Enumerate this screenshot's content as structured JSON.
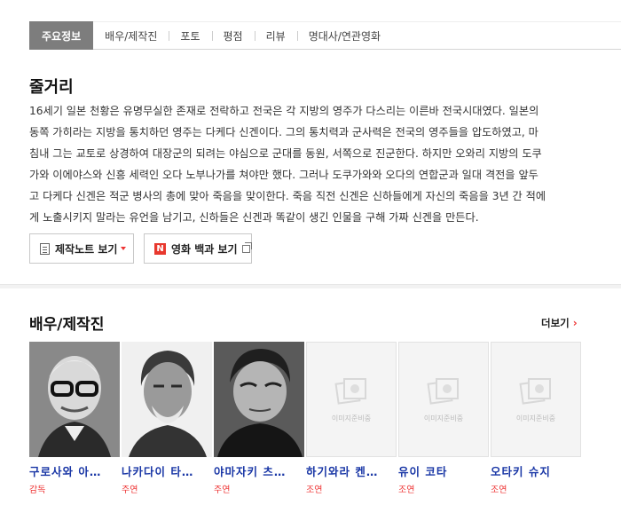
{
  "tabs": [
    {
      "label": "주요정보"
    },
    {
      "label": "배우/제작진"
    },
    {
      "label": "포토"
    },
    {
      "label": "평점"
    },
    {
      "label": "리뷰"
    },
    {
      "label": "명대사/연관영화"
    }
  ],
  "synopsis": {
    "title": "줄거리",
    "lines": [
      "16세기 일본 천황은 유명무실한 존재로 전락하고 전국은 각 지방의 영주가 다스리는 이른바 전국시대였다. 일본의",
      "동쪽 가히라는 지방을 통치하던 영주는 다케다 신겐이다. 그의 통치력과 군사력은 전국의 영주들을 압도하였고, 마",
      "침내 그는 교토로 상경하여 대장군의 되려는 야심으로 군대를 동원, 서쪽으로 진군한다. 하지만 오와리 지방의 도쿠",
      "가와 이에야스와 신흥 세력인 오다 노부나가를 쳐야만 했다. 그러나 도쿠가와와 오다의 연합군과 일대 격전을 앞두",
      "고 다케다 신겐은 적군 병사의 총에 맞아 죽음을 맞이한다. 죽음 직전 신겐은 신하들에게 자신의 죽음을 3년 간 적에",
      "게 노출시키지 말라는 유언을 남기고, 신하들은 신겐과 똑같이 생긴 인물을 구해 가짜 신겐을 만든다."
    ],
    "buttons": {
      "production_note": "제작노트 보기",
      "encyclopedia": "영화 백과 보기",
      "n_badge": "N"
    }
  },
  "cast": {
    "title": "배우/제작진",
    "more": "더보기",
    "placeholder_text": "이미지준비중",
    "members": [
      {
        "name": "구로사와 아…",
        "role": "감독",
        "photo": "real"
      },
      {
        "name": "나카다이 타…",
        "role": "주연",
        "photo": "real"
      },
      {
        "name": "야마자키 츠…",
        "role": "주연",
        "photo": "real"
      },
      {
        "name": "하기와라 켄…",
        "role": "조연",
        "photo": "none"
      },
      {
        "name": "유이 코타",
        "role": "조연",
        "photo": "none"
      },
      {
        "name": "오타키 슈지",
        "role": "조연",
        "photo": "none"
      }
    ]
  },
  "colors": {
    "accent_red": "#e33333",
    "name_blue": "#1a37a6",
    "active_tab": "#7d7d7d"
  }
}
